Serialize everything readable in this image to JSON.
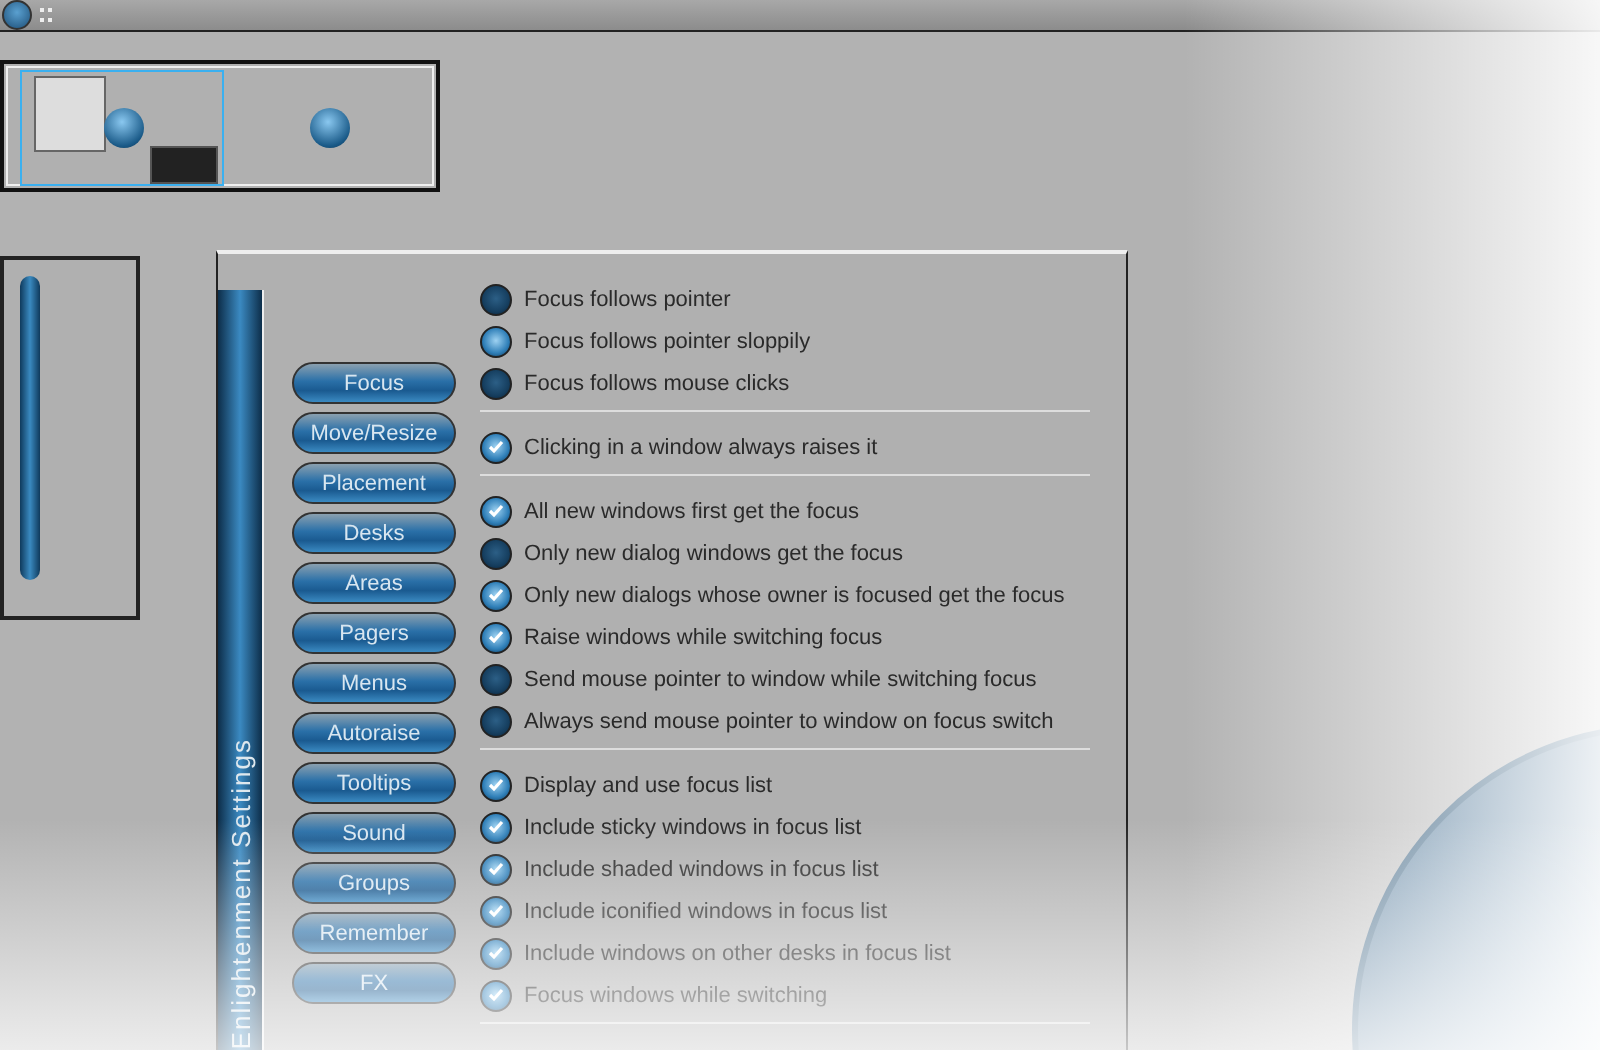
{
  "settings_window": {
    "title": "Enlightenment Settings",
    "categories": [
      "Focus",
      "Move/Resize",
      "Placement",
      "Desks",
      "Areas",
      "Pagers",
      "Menus",
      "Autoraise",
      "Tooltips",
      "Sound",
      "Groups",
      "Remember",
      "FX"
    ],
    "option_groups": [
      [
        {
          "kind": "radio",
          "label": "Focus follows pointer",
          "selected": false
        },
        {
          "kind": "radio",
          "label": "Focus follows pointer sloppily",
          "selected": true
        },
        {
          "kind": "radio",
          "label": "Focus follows mouse clicks",
          "selected": false
        }
      ],
      [
        {
          "kind": "check",
          "label": "Clicking in a window always raises it",
          "checked": true
        }
      ],
      [
        {
          "kind": "check",
          "label": "All new windows first get the focus",
          "checked": true
        },
        {
          "kind": "check",
          "label": "Only new dialog windows get the focus",
          "checked": false
        },
        {
          "kind": "check",
          "label": "Only new dialogs whose owner is focused get the focus",
          "checked": true
        },
        {
          "kind": "check",
          "label": "Raise windows while switching focus",
          "checked": true
        },
        {
          "kind": "check",
          "label": "Send mouse pointer to window while switching focus",
          "checked": false
        },
        {
          "kind": "check",
          "label": "Always send mouse pointer to window on focus switch",
          "checked": false
        }
      ],
      [
        {
          "kind": "check",
          "label": "Display and use focus list",
          "checked": true
        },
        {
          "kind": "check",
          "label": "Include sticky windows in focus list",
          "checked": true
        },
        {
          "kind": "check",
          "label": "Include shaded windows in focus list",
          "checked": true
        },
        {
          "kind": "check",
          "label": "Include iconified windows in focus list",
          "checked": true
        },
        {
          "kind": "check",
          "label": "Include windows on other desks in focus list",
          "checked": true
        },
        {
          "kind": "check",
          "label": "Focus windows while switching",
          "checked": true
        }
      ]
    ]
  }
}
